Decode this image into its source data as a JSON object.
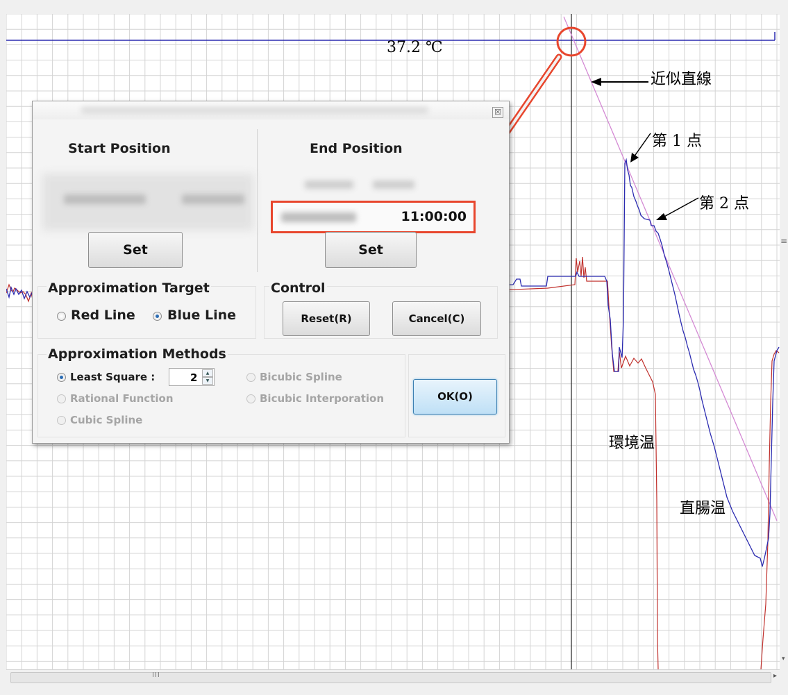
{
  "annotations": {
    "temp_label": "37.2 ℃",
    "approx_line": "近似直線",
    "point1": "第 1 点",
    "point2": "第 2 点",
    "ambient": "環境温",
    "rectal": "直腸温"
  },
  "dialog": {
    "close_glyph": "☒",
    "start": {
      "title": "Start Position",
      "set_label": "Set"
    },
    "end": {
      "title": "End Position",
      "value": "11:00:00",
      "set_label": "Set"
    },
    "target": {
      "title": "Approximation Target",
      "red": "Red Line",
      "blue": "Blue Line",
      "selected": "Blue Line"
    },
    "control": {
      "title": "Control",
      "reset": "Reset(R)",
      "cancel": "Cancel(C)"
    },
    "methods": {
      "title": "Approximation Methods",
      "least_square": "Least Square :",
      "degree": "2",
      "rational": "Rational Function",
      "cubic": "Cubic Spline",
      "bicubic_spline": "Bicubic Spline",
      "bicubic_interp": "Bicubic Interporation",
      "selected": "Least Square :"
    },
    "ok": "OK(O)"
  },
  "scrollbar": {
    "grip": "III",
    "right_arrow": "▸",
    "down_arrow": "▾",
    "side_mark": "≡"
  },
  "colors": {
    "blue_line": "#2b2bb0",
    "red_line": "#c0302c",
    "approx_line": "#d48ad4",
    "highlight": "#e8462d",
    "grid": "#d4d4d4"
  }
}
